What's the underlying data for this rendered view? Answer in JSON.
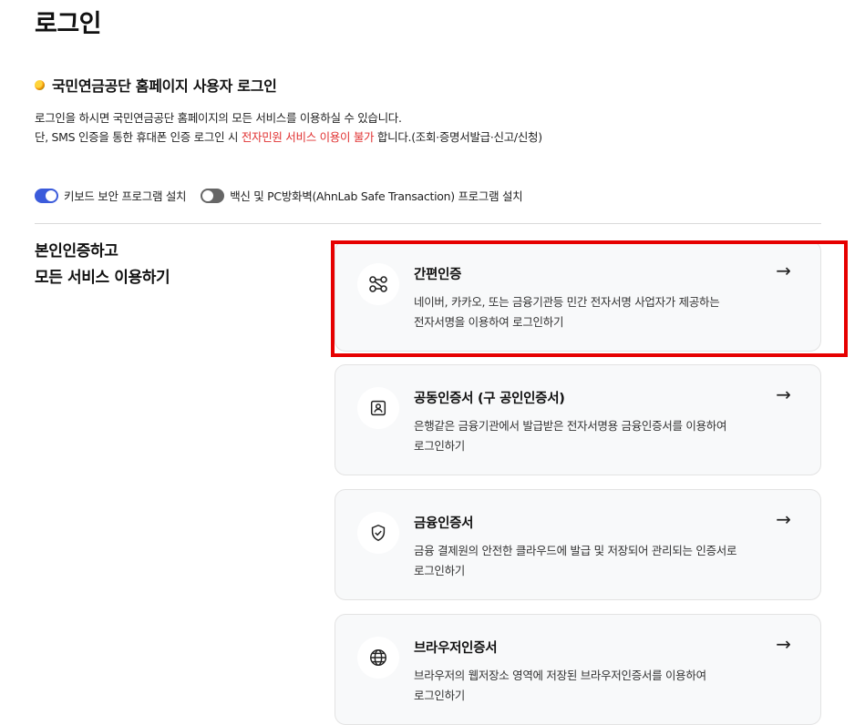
{
  "page": {
    "title": "로그인"
  },
  "section": {
    "title": "국민연금공단 홈페이지 사용자 로그인",
    "desc_line1": "로그인을 하시면 국민연금공단 홈페이지의 모든 서비스를 이용하실 수 있습니다.",
    "desc_line2_pre": "단, SMS 인증을 통한 휴대폰 인증 로그인 시 ",
    "desc_line2_warn": "전자민원 서비스 이용이 불가",
    "desc_line2_post": " 합니다.(조회·증명서발급·신고/신청)"
  },
  "toggles": [
    {
      "label": "키보드 보안 프로그램 설치",
      "state": "on"
    },
    {
      "label": "백신 및 PC방화벽(AhnLab Safe Transaction) 프로그램 설치",
      "state": "off"
    }
  ],
  "side_heading": {
    "line1": "본인인증하고",
    "line2": "모든 서비스 이용하기"
  },
  "cards": [
    {
      "title": "간편인증",
      "desc1": "네이버, 카카오, 또는 금융기관등 민간 전자서명 사업자가 제공하는",
      "desc2": "전자서명을 이용하여 로그인하기",
      "icon": "link-nodes-icon"
    },
    {
      "title": "공동인증서 (구 공인인증서)",
      "desc1": "은행같은 금융기관에서 발급받은 전자서명용 금융인증서를 이용하여",
      "desc2": "로그인하기",
      "icon": "id-card-icon"
    },
    {
      "title": "금융인증서",
      "desc1": "금융 결제원의 안전한 클라우드에 발급 및 저장되어 관리되는 인증서로",
      "desc2": "로그인하기",
      "icon": "shield-check-icon"
    },
    {
      "title": "브라우저인증서",
      "desc1": "브라우저의 웹저장소 영역에 저장된 브라우저인증서를 이용하여",
      "desc2": "로그인하기",
      "icon": "globe-icon"
    }
  ],
  "arrow_glyph": "→",
  "colors": {
    "accent": "#3b5bdb",
    "warn": "#e03131",
    "highlight": "#e60000"
  }
}
